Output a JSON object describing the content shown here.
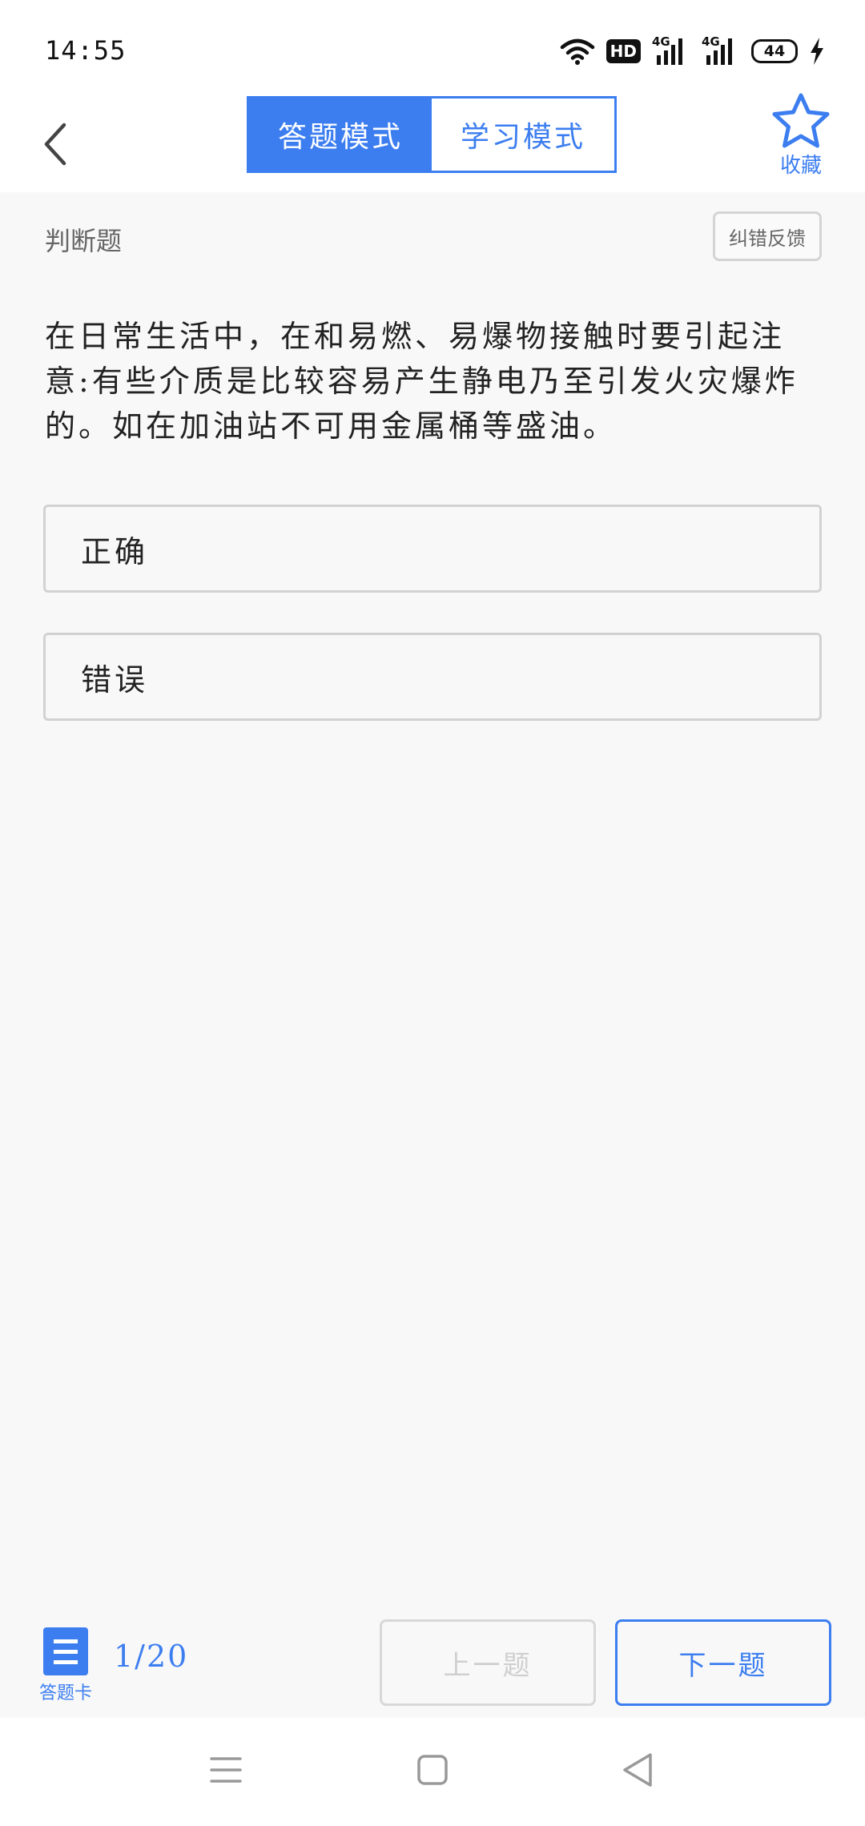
{
  "status_bar": {
    "time": "14:55",
    "hd_badge": "HD",
    "signal1_label": "4G",
    "signal2_label": "4G",
    "battery": "44"
  },
  "header": {
    "mode_tabs": [
      {
        "label": "答题模式",
        "active": true
      },
      {
        "label": "学习模式",
        "active": false
      }
    ],
    "favorite_label": "收藏"
  },
  "question": {
    "type": "判断题",
    "feedback_label": "纠错反馈",
    "text": "在日常生活中，在和易燃、易爆物接触时要引起注意:有些介质是比较容易产生静电乃至引发火灾爆炸的。如在加油站不可用金属桶等盛油。",
    "options": [
      "正确",
      "错误"
    ]
  },
  "footer": {
    "answer_card_label": "答题卡",
    "progress": "1/20",
    "prev_label": "上一题",
    "next_label": "下一题"
  },
  "colors": {
    "accent": "#3c7ef0",
    "background": "#f8f8f8",
    "disabled": "#cfcfcf"
  },
  "icons": [
    "back-icon",
    "star-icon",
    "wifi-icon",
    "charging-icon",
    "answer-card-icon",
    "menu-nav-icon",
    "home-nav-icon",
    "back-nav-icon"
  ]
}
